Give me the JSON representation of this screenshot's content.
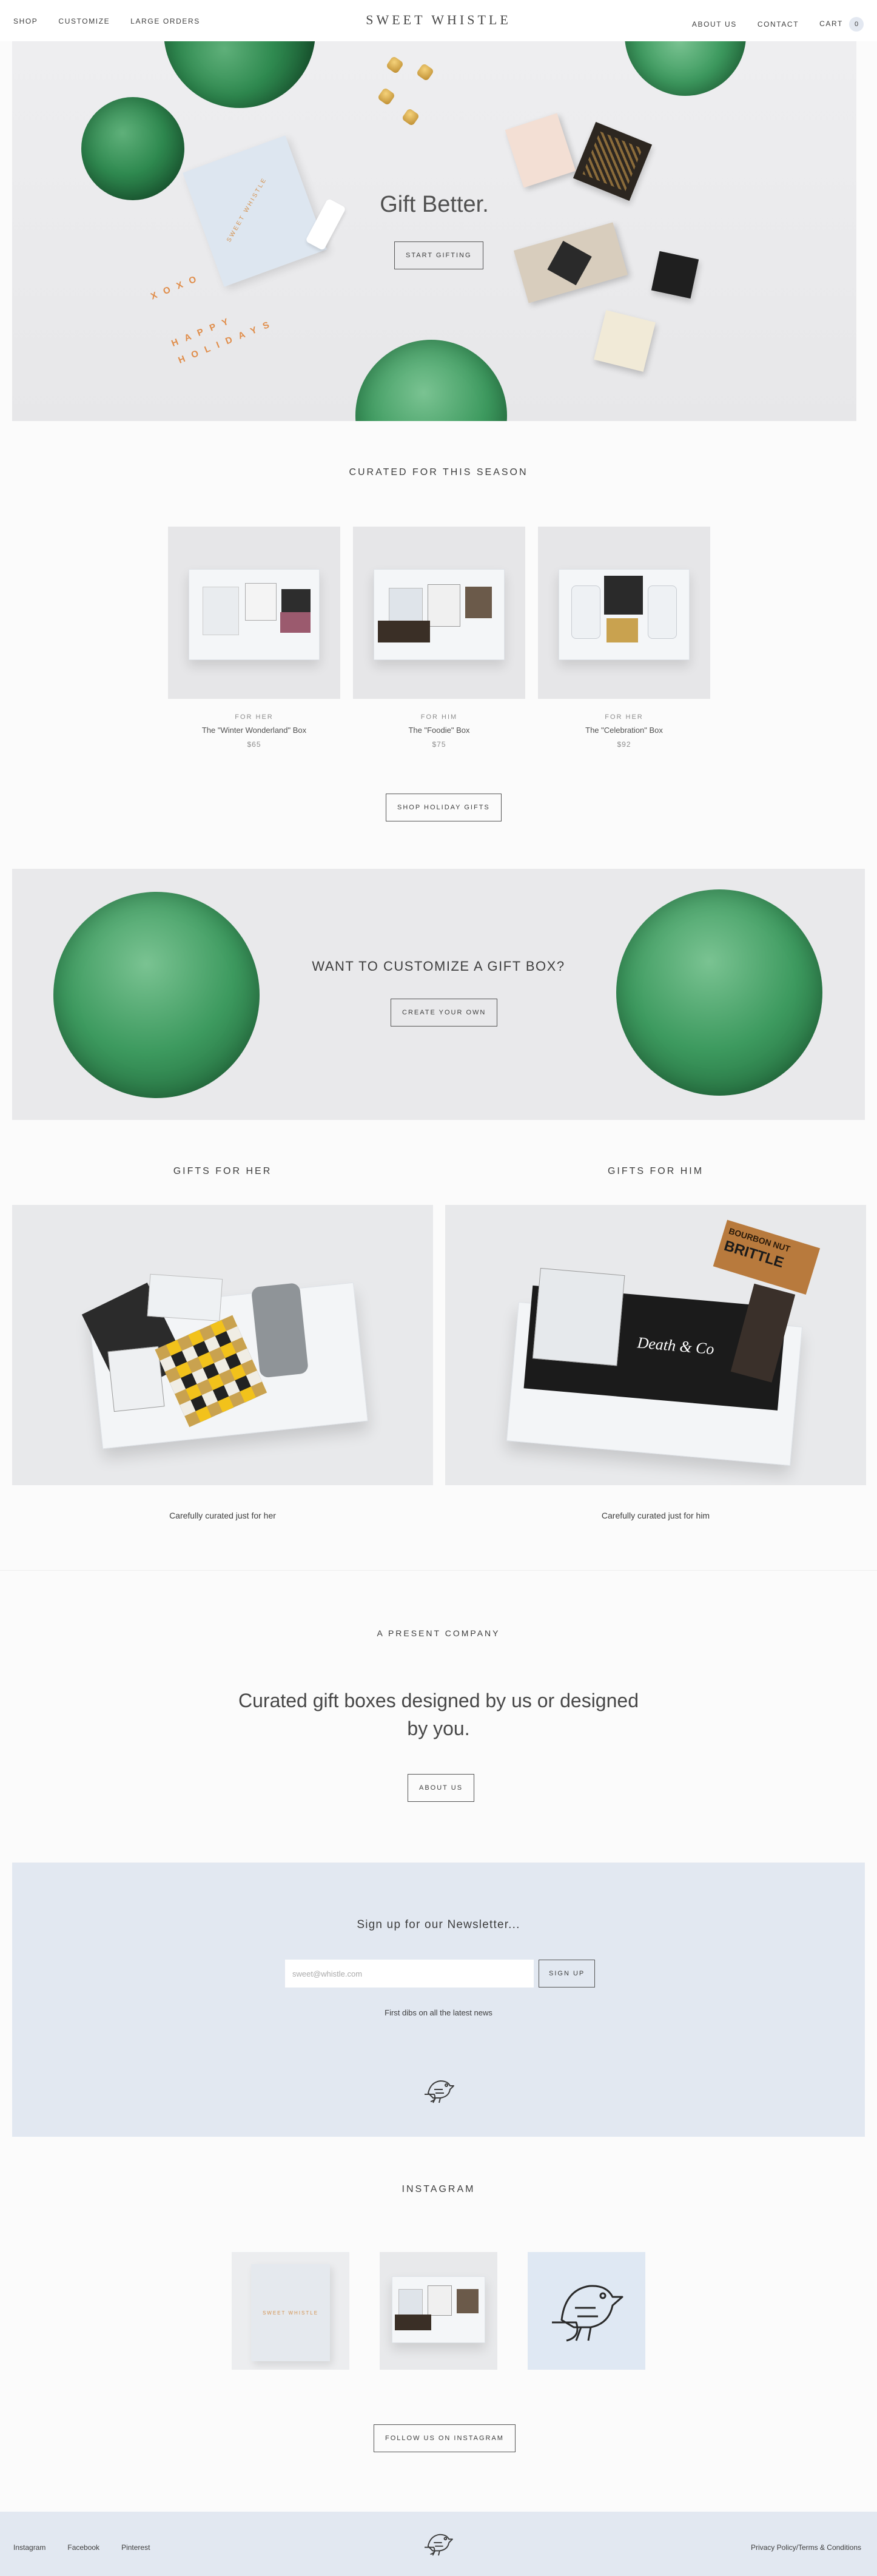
{
  "header": {
    "nav_left": [
      "SHOP",
      "CUSTOMIZE",
      "LARGE ORDERS"
    ],
    "brand": "SWEET WHISTLE",
    "nav_right": [
      "ABOUT US",
      "CONTACT",
      "CART"
    ],
    "cart_count": "0"
  },
  "hero": {
    "title": "Gift Better.",
    "cta": "START GIFTING",
    "card_text_1": "XOXO",
    "card_text_2": "HAPPY HOLIDAYS",
    "box_label": "SWEET WHISTLE"
  },
  "curated": {
    "title": "CURATED FOR THIS SEASON",
    "products": [
      {
        "category": "FOR HER",
        "name": "The \"Winter Wonderland\" Box",
        "price": "$65"
      },
      {
        "category": "FOR HIM",
        "name": "The \"Foodie\" Box",
        "price": "$75"
      },
      {
        "category": "FOR HER",
        "name": "The \"Celebration\" Box",
        "price": "$92"
      }
    ],
    "cta": "SHOP HOLIDAY GIFTS"
  },
  "customize": {
    "title": "WANT TO CUSTOMIZE A GIFT BOX?",
    "cta": "CREATE YOUR OWN"
  },
  "gifts": {
    "her": {
      "title": "GIFTS FOR HER",
      "caption": "Carefully curated just for her"
    },
    "him": {
      "title": "GIFTS FOR HIM",
      "caption": "Carefully curated just for him"
    },
    "him_box_text": "Death & Co",
    "him_brittle_top": "BOURBON NUT",
    "him_brittle_bottom": "BRITTLE"
  },
  "about": {
    "kicker": "A PRESENT COMPANY",
    "headline": "Curated gift boxes designed by us or designed by you.",
    "cta": "ABOUT US"
  },
  "newsletter": {
    "title": "Sign up for our Newsletter...",
    "placeholder": "sweet@whistle.com",
    "cta": "SIGN UP",
    "subtitle": "First dibs on all the latest news"
  },
  "instagram": {
    "title": "INSTAGRAM",
    "cta": "FOLLOW US ON INSTAGRAM"
  },
  "footer": {
    "links": [
      "Instagram",
      "Facebook",
      "Pinterest"
    ],
    "legal": "Privacy Policy/Terms & Conditions"
  },
  "icons": [
    "bird-logo-icon"
  ],
  "colors": {
    "accent": "#e2e8f1",
    "text": "#3d3d3d",
    "orange": "#e08d4a"
  }
}
